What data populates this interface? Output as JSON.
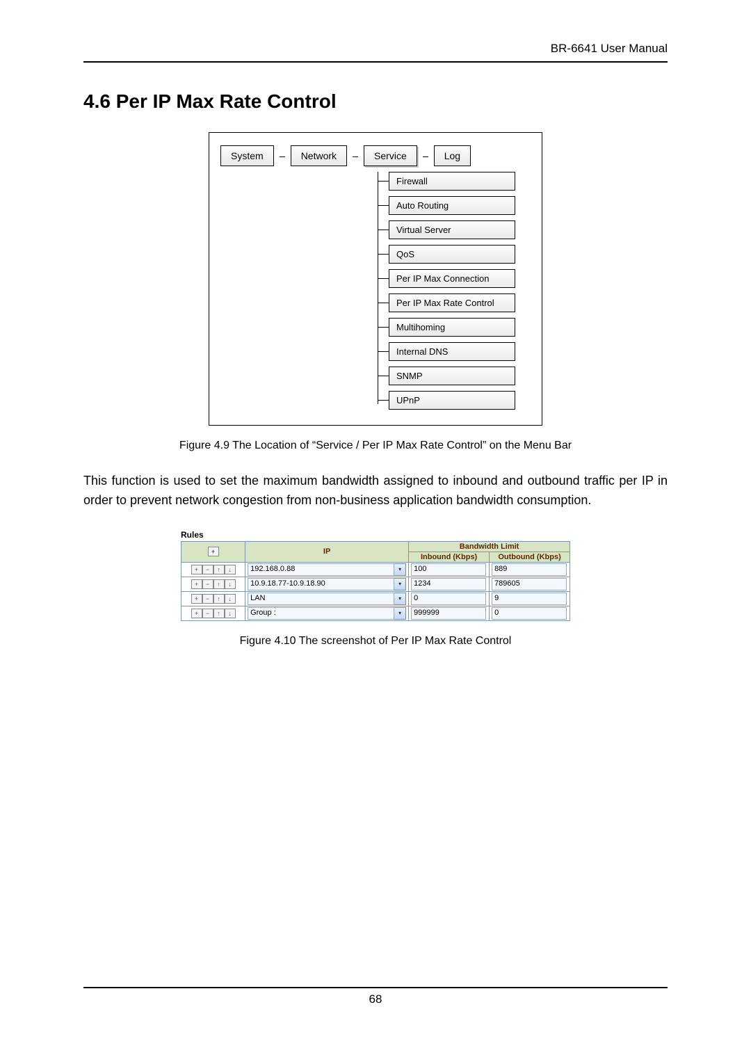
{
  "header": {
    "right": "BR-6641 User Manual"
  },
  "section": {
    "title": "4.6 Per IP Max Rate Control"
  },
  "menu": {
    "tabs": [
      "System",
      "Network",
      "Service",
      "Log"
    ],
    "service_items": [
      "Firewall",
      "Auto Routing",
      "Virtual Server",
      "QoS",
      "Per IP Max Connection",
      "Per IP Max Rate Control",
      "Multihoming",
      "Internal DNS",
      "SNMP",
      "UPnP"
    ]
  },
  "captions": {
    "fig49": "Figure 4.9 The Location of “Service / Per IP Max Rate Control” on the Menu Bar",
    "fig410": "Figure 4.10 The screenshot of Per IP Max Rate Control"
  },
  "paragraph": "This function is used to set the maximum bandwidth assigned to inbound and outbound traffic per IP in order to prevent network congestion from non-business application bandwidth consumption.",
  "rules": {
    "title": "Rules",
    "headers": {
      "add": "+",
      "ip": "IP",
      "bw": "Bandwidth Limit",
      "in": "Inbound (Kbps)",
      "out": "Outbound (Kbps)"
    },
    "action_icons": [
      "+",
      "−",
      "↑",
      "↓"
    ],
    "rows": [
      {
        "ip": "192.168.0.88",
        "in": "100",
        "out": "889"
      },
      {
        "ip": "10.9.18.77-10.9.18.90",
        "in": "1234",
        "out": "789605"
      },
      {
        "ip": "LAN",
        "in": "0",
        "out": "9"
      },
      {
        "ip": "Group :",
        "in": "999999",
        "out": "0"
      }
    ]
  },
  "footer": {
    "page": "68"
  }
}
